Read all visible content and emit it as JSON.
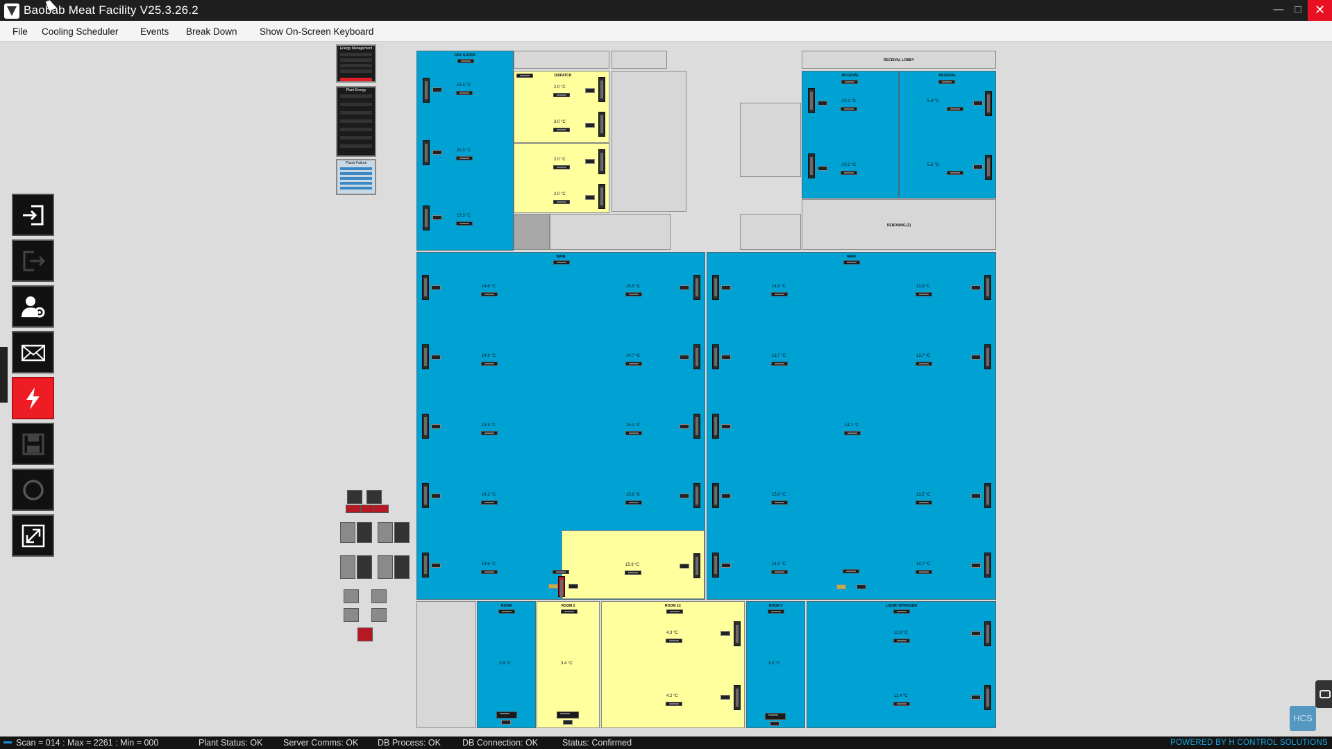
{
  "window": {
    "title": "Baobab Meat Facility V25.3.26.2",
    "minimize": "—",
    "maximize": "□",
    "close": "✕"
  },
  "menu": [
    {
      "label": "File"
    },
    {
      "label": "Cooling Scheduler"
    },
    {
      "label": "Events"
    },
    {
      "label": "Break Down"
    },
    {
      "label": "Show On-Screen Keyboard"
    }
  ],
  "toolbar": {
    "buttons": [
      {
        "icon": "login-icon"
      },
      {
        "icon": "logout-icon"
      },
      {
        "icon": "user-settings-icon"
      },
      {
        "icon": "mail-icon"
      },
      {
        "icon": "lightning-icon",
        "color": "#ee1c24"
      },
      {
        "icon": "save-icon"
      },
      {
        "icon": "refresh-icon"
      },
      {
        "icon": "fullscreen-icon"
      }
    ]
  },
  "panels": {
    "energy_management": "Energy Management",
    "plant_energy": "Plant Energy",
    "phase_failure": "Phase Failure"
  },
  "rooms": {
    "dry_goods": {
      "label": "DRY GOODS",
      "temps": [
        "15.4 °C",
        "20.3 °C",
        "15.3 °C"
      ]
    },
    "dispatch": {
      "label": "DISPATCH",
      "temps": [
        "2.0 °C",
        "3.0 °C",
        "2.0 °C",
        "2.0 °C"
      ]
    },
    "receival_lobby": {
      "label": "RECEIVAL LOBBY"
    },
    "receival_a": {
      "label": "RECEIVAL",
      "temps": [
        "-10.1 °C",
        "-10.2 °C"
      ]
    },
    "receival_b": {
      "label": "RECEIVAL",
      "temps": [
        "-5.4 °C",
        "-5.5 °C"
      ]
    },
    "deboning": {
      "label": "DEBONING (3)"
    },
    "main_a": {
      "label": "MAIN",
      "left_temps": [
        "14.6 °C",
        "14.6 °C",
        "13.9 °C",
        "14.2 °C",
        "14.6 °C"
      ],
      "right_temps": [
        "15.5 °C",
        "14.7 °C",
        "15.1 °C",
        "15.9 °C",
        "15.9 °C"
      ]
    },
    "main_b": {
      "label": "MAIN",
      "left_temps": [
        "14.0 °C",
        "13.7 °C",
        "15.0 °C",
        "14.0 °C"
      ],
      "right_temps": [
        "13.9 °C",
        "13.7 °C",
        "13.5 °C",
        "14.7 °C"
      ],
      "center_temp": "14.1 °C"
    },
    "room_a": {
      "label": "ROOM",
      "temp": "3.9 °C"
    },
    "room_b": {
      "label": "ROOM 2",
      "temp": "3.4 °C"
    },
    "room_c": {
      "label": "ROOM 1C",
      "temps": [
        "4.3 °C",
        "4.2 °C"
      ]
    },
    "room_d": {
      "label": "ROOM 3",
      "temp": "1.0 °C"
    },
    "liquid_nitrogen": {
      "label": "LIQUID NITROGEN",
      "temps": [
        "11.8 °C",
        "11.4 °C"
      ]
    }
  },
  "status": {
    "scan": "Scan = 014 : Max = 2261 : Min = 000",
    "plant": "Plant Status: OK",
    "server": "Server Comms: OK",
    "db_process": "DB Process:  OK",
    "db_connection": "DB Connection:  OK",
    "state": "Status:  Confirmed",
    "powered_by": "POWERED BY H CONTROL SOLUTIONS"
  },
  "logo": "HCS",
  "colors": {
    "room_blue": "#00a2d4",
    "room_yellow": "#ffff9e",
    "alarm_red": "#ee1c24",
    "powered_by": "#1aa6e0"
  }
}
